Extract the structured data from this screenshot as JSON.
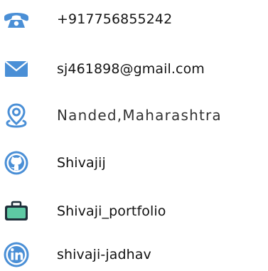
{
  "contact": {
    "phone": {
      "icon": "phone-icon",
      "text": "+917756855242"
    },
    "email": {
      "icon": "envelope-icon",
      "text": "sj461898@gmail.com"
    },
    "location": {
      "icon": "location-pin-icon",
      "text": "Nanded,Maharashtra"
    },
    "github": {
      "icon": "github-icon",
      "text": "Shivajij"
    },
    "portfolio": {
      "icon": "briefcase-icon",
      "text": "Shivaji_portfolio"
    },
    "linkedin": {
      "icon": "linkedin-icon",
      "text": "shivaji-jadhav"
    }
  },
  "colors": {
    "primary_icon": "#4a8fd6",
    "portfolio_fill": "#5ec9a4",
    "portfolio_dark": "#1f2f3a"
  }
}
